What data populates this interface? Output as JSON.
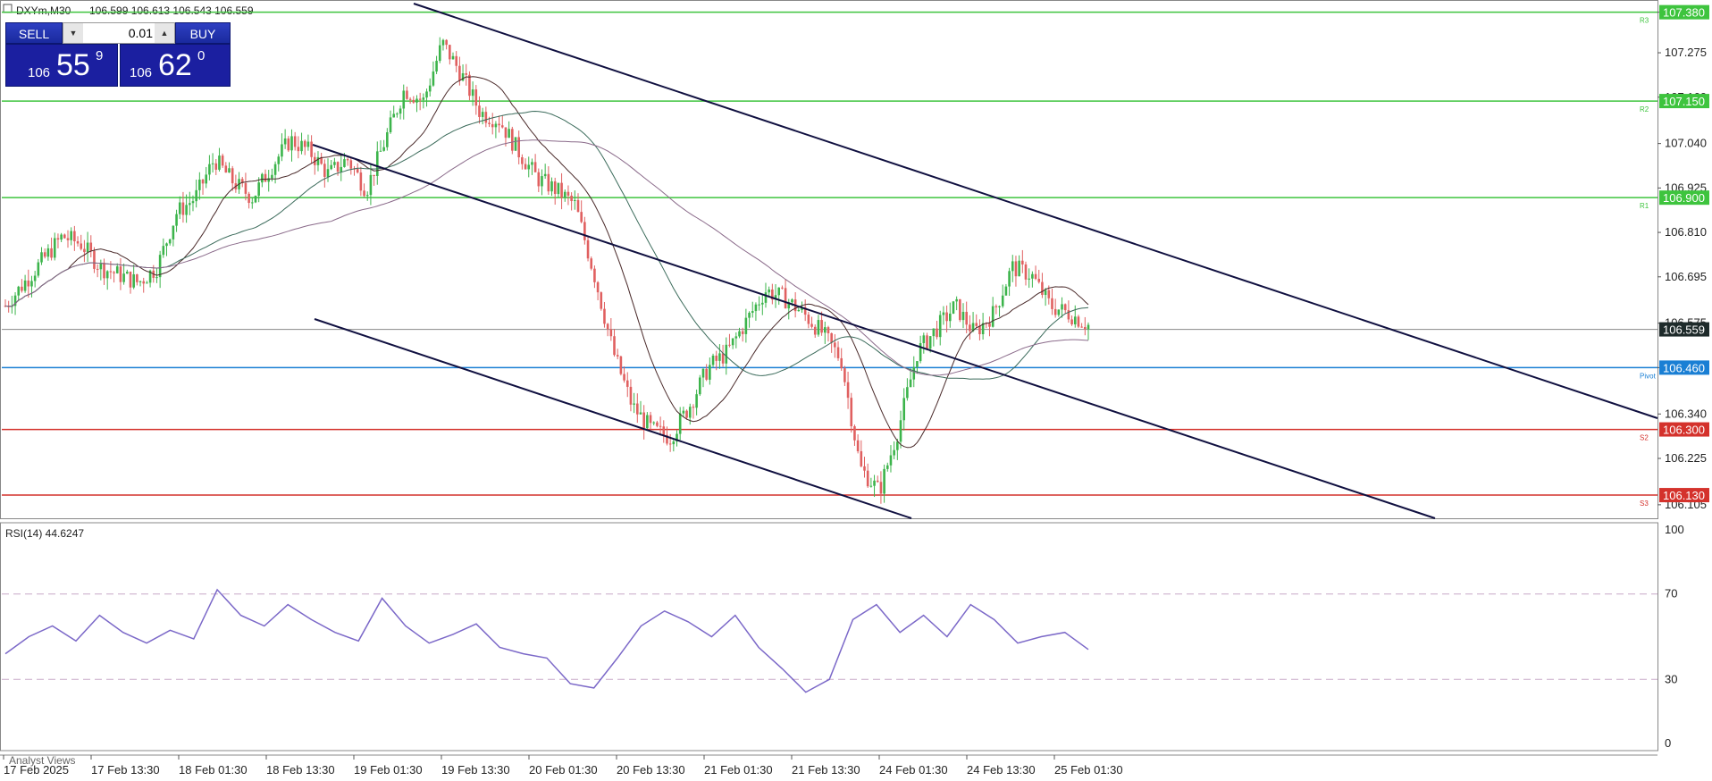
{
  "header": {
    "symbol_line": "DXYm,M30",
    "ohlc": "106.599 106.613 106.543 106.559"
  },
  "trade_panel": {
    "sell_label": "SELL",
    "buy_label": "BUY",
    "lot_value": "0.01",
    "sell_price_prefix": "106",
    "sell_price_big": "55",
    "sell_price_sup": "9",
    "buy_price_prefix": "106",
    "buy_price_big": "62",
    "buy_price_sup": "0"
  },
  "price_axis": {
    "ticks": [
      "107.380",
      "107.275",
      "107.160",
      "107.040",
      "106.925",
      "106.810",
      "106.695",
      "106.575",
      "106.460",
      "106.340",
      "106.225",
      "106.105"
    ],
    "current_price": "106.559"
  },
  "levels": [
    {
      "value": 107.38,
      "label": "107.380",
      "tag": "R3",
      "color": "#3ec43e"
    },
    {
      "value": 107.15,
      "label": "107.150",
      "tag": "R2",
      "color": "#3ec43e"
    },
    {
      "value": 106.9,
      "label": "106.900",
      "tag": "R1",
      "color": "#3ec43e"
    },
    {
      "value": 106.46,
      "label": "106.460",
      "tag": "Pivot",
      "color": "#1a7fd4"
    },
    {
      "value": 106.3,
      "label": "106.300",
      "tag": "S2",
      "color": "#d4322c"
    },
    {
      "value": 106.13,
      "label": "106.130",
      "tag": "S3",
      "color": "#d4322c"
    }
  ],
  "rsi": {
    "label": "RSI(14) 44.6247",
    "ticks": [
      "100",
      "70",
      "30",
      "0"
    ]
  },
  "time_axis": {
    "labels": [
      "17 Feb 2025",
      "17 Feb 13:30",
      "18 Feb 01:30",
      "18 Feb 13:30",
      "19 Feb 01:30",
      "19 Feb 13:30",
      "20 Feb 01:30",
      "20 Feb 13:30",
      "21 Feb 01:30",
      "21 Feb 13:30",
      "24 Feb 01:30",
      "24 Feb 13:30",
      "25 Feb 01:30"
    ]
  },
  "analyst_label": "Analyst Views",
  "colors": {
    "bull": "#3cb44b",
    "bear": "#e06060",
    "channel": "#101040",
    "rsi_line": "#7b68c8",
    "ma_fast": "#4a2a2a",
    "ma_mid": "#3a6a5a",
    "ma_slow": "#8a6a8a"
  },
  "chart_data": {
    "type": "candlestick",
    "timeframe": "M30",
    "close_path": [
      106.62,
      106.68,
      106.74,
      106.8,
      106.78,
      106.72,
      106.7,
      106.68,
      106.72,
      106.86,
      106.9,
      107.0,
      106.94,
      106.9,
      106.98,
      107.05,
      107.02,
      106.96,
      107.0,
      106.92,
      107.05,
      107.18,
      107.15,
      107.3,
      107.22,
      107.12,
      107.1,
      107.02,
      106.95,
      106.92,
      106.88,
      106.7,
      106.5,
      106.36,
      106.3,
      106.28,
      106.36,
      106.46,
      106.5,
      106.58,
      106.66,
      106.64,
      106.6,
      106.55,
      106.48,
      106.2,
      106.14,
      106.3,
      106.5,
      106.56,
      106.62,
      106.55,
      106.6,
      106.72,
      106.7,
      106.62,
      106.6,
      106.57
    ],
    "rsi_path": [
      42,
      50,
      55,
      48,
      60,
      52,
      47,
      53,
      49,
      72,
      60,
      55,
      65,
      58,
      52,
      48,
      68,
      55,
      47,
      51,
      56,
      45,
      42,
      40,
      28,
      26,
      40,
      55,
      62,
      57,
      50,
      60,
      45,
      35,
      24,
      30,
      58,
      65,
      52,
      60,
      50,
      65,
      58,
      47,
      50,
      52,
      44
    ],
    "ylim": [
      106.07,
      107.4
    ],
    "rsi_ylim": [
      0,
      100
    ]
  }
}
